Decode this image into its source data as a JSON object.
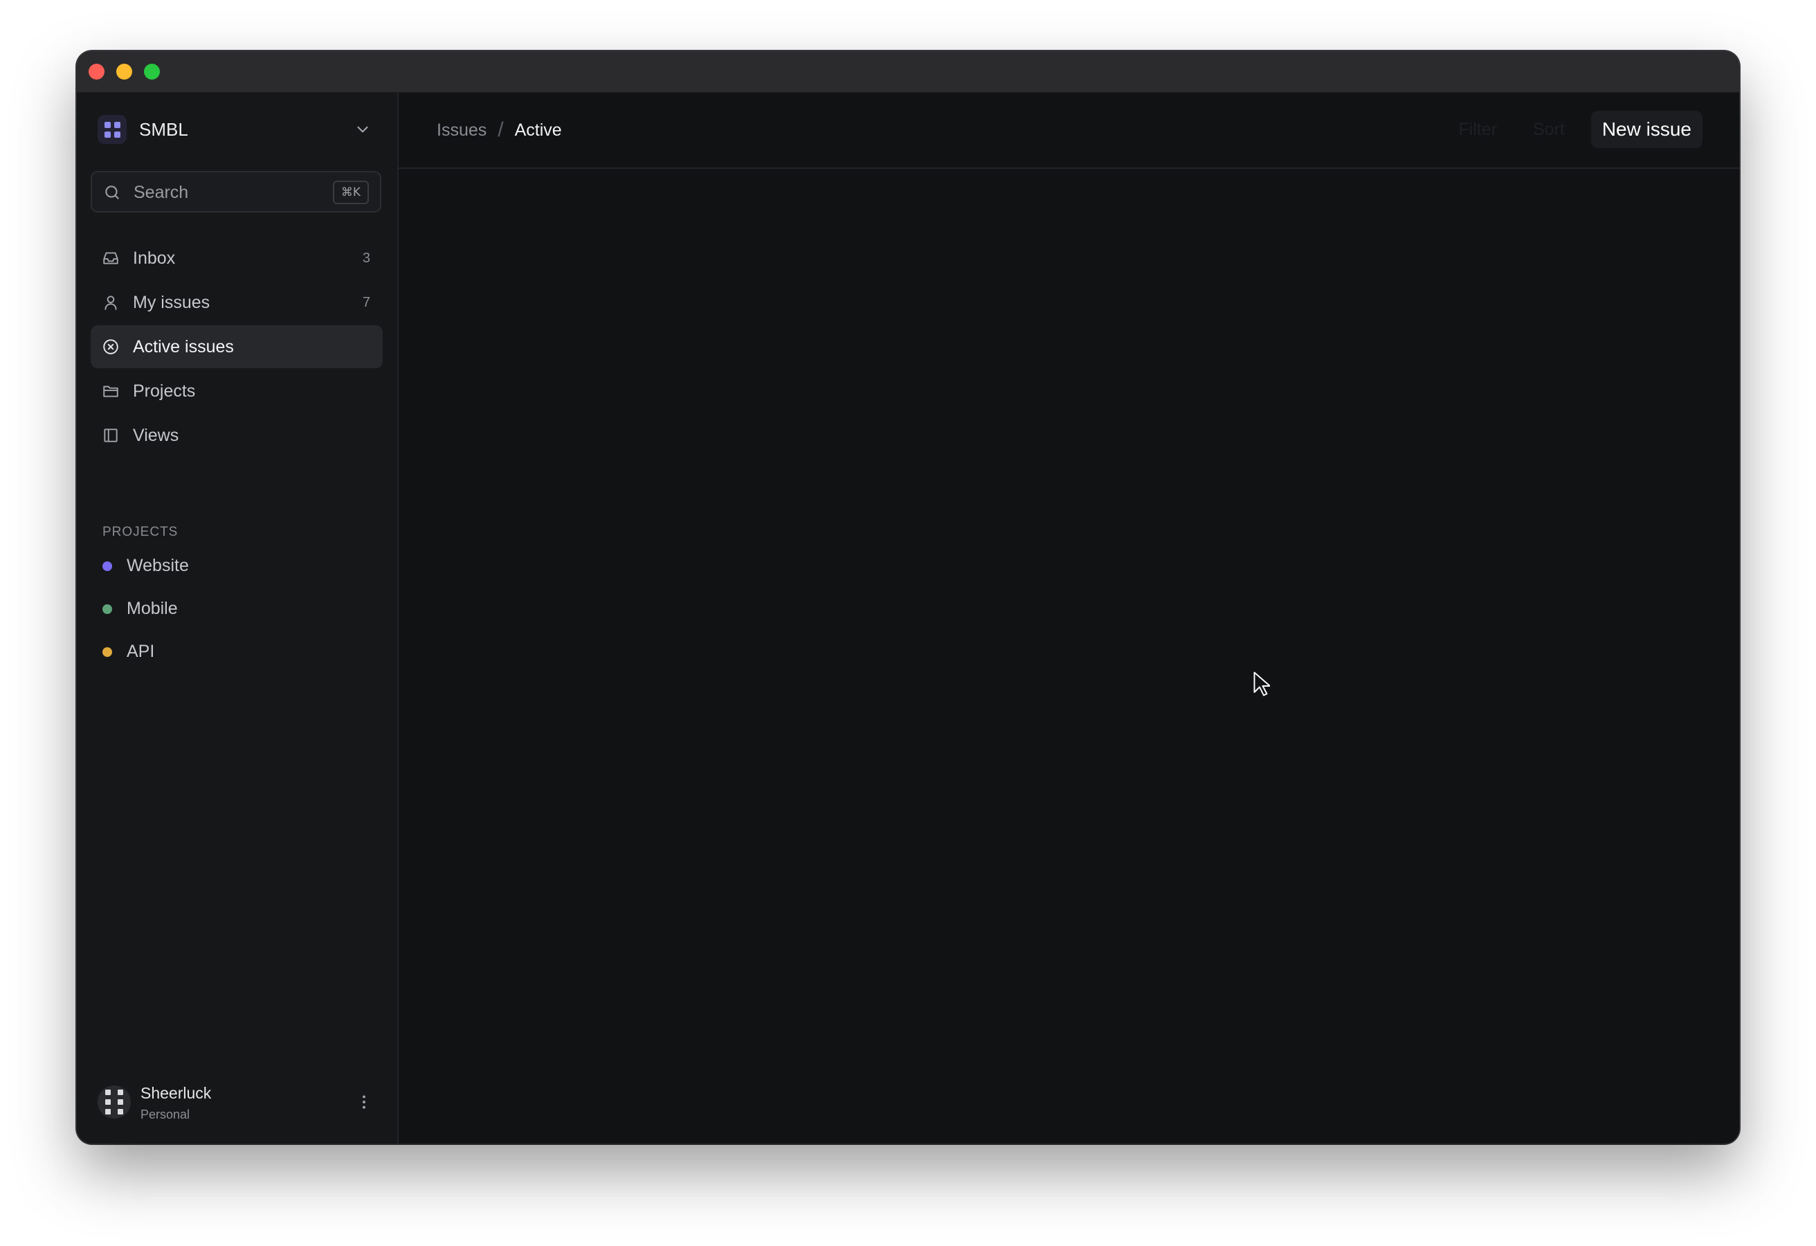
{
  "window": {
    "controls": [
      "close",
      "minimize",
      "maximize"
    ]
  },
  "sidebar": {
    "workspace": {
      "name": "SMBL",
      "logo_icon": "grid-icon",
      "menu_icon": "chevron-down-icon"
    },
    "search": {
      "placeholder": "Search",
      "value": "",
      "shortcut": "⌘K",
      "icon": "search-icon"
    },
    "nav": [
      {
        "label": "Inbox",
        "count": "3",
        "icon": "inbox-icon",
        "active": false
      },
      {
        "label": "My issues",
        "count": "7",
        "icon": "user-icon",
        "active": false
      },
      {
        "label": "Active issues",
        "count": "",
        "icon": "circle-x-icon",
        "active": true
      },
      {
        "label": "Projects",
        "count": "",
        "icon": "folder-icon",
        "active": false
      },
      {
        "label": "Views",
        "count": "",
        "icon": "layout-icon",
        "active": false
      }
    ],
    "projects_title": "PROJECTS",
    "projects": [
      {
        "label": "Website",
        "color": "#7b6cf6"
      },
      {
        "label": "Mobile",
        "color": "#5fa37a"
      },
      {
        "label": "API",
        "color": "#e2a93b"
      }
    ],
    "user": {
      "name": "Sheerluck",
      "plan": "Personal",
      "menu_icon": "more-vertical-icon"
    }
  },
  "header": {
    "breadcrumb": {
      "parent": "Issues",
      "separator": "/",
      "current": "Active"
    },
    "actions": {
      "filter": "Filter",
      "sort": "Sort",
      "new_issue": "New issue"
    }
  },
  "colors": {
    "accent": "#8f8cf0",
    "background": "#111214",
    "sidebar": "#161719"
  }
}
